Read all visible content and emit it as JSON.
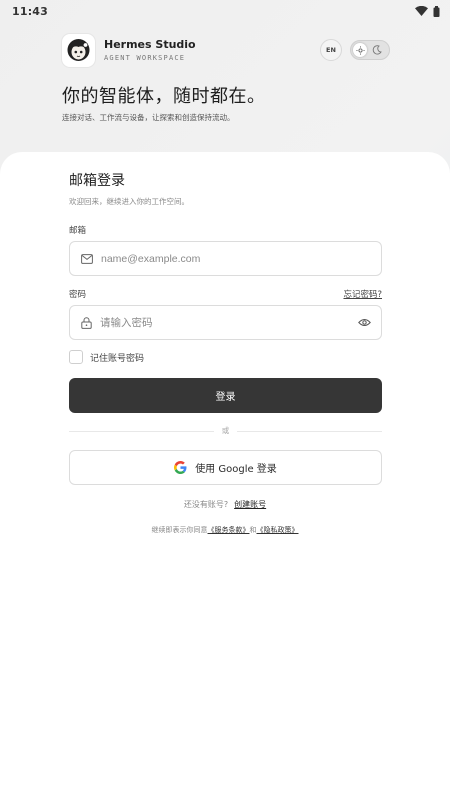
{
  "status_bar": {
    "time": "11:43"
  },
  "brand": {
    "name": "Hermes Studio",
    "subtitle": "AGENT WORKSPACE"
  },
  "controls": {
    "language": "EN"
  },
  "hero": {
    "title": "你的智能体，随时都在。",
    "subtitle": "连接对话、工作流与设备，让探索和创造保持流动。"
  },
  "form": {
    "title": "邮箱登录",
    "subtitle": "欢迎回来，继续进入你的工作空间。",
    "email_label": "邮箱",
    "email_placeholder": "name@example.com",
    "password_label": "密码",
    "forgot_label": "忘记密码?",
    "password_placeholder": "请输入密码",
    "remember_label": "记住账号密码",
    "login_label": "登录",
    "divider_text": "或",
    "google_label": "使用 Google 登录"
  },
  "signup": {
    "prompt": "还没有账号?",
    "link": "创建账号"
  },
  "terms": {
    "prefix": "继续即表示你同意",
    "service": "《服务条款》",
    "conjunction": "和",
    "privacy": "《隐私政策》"
  }
}
